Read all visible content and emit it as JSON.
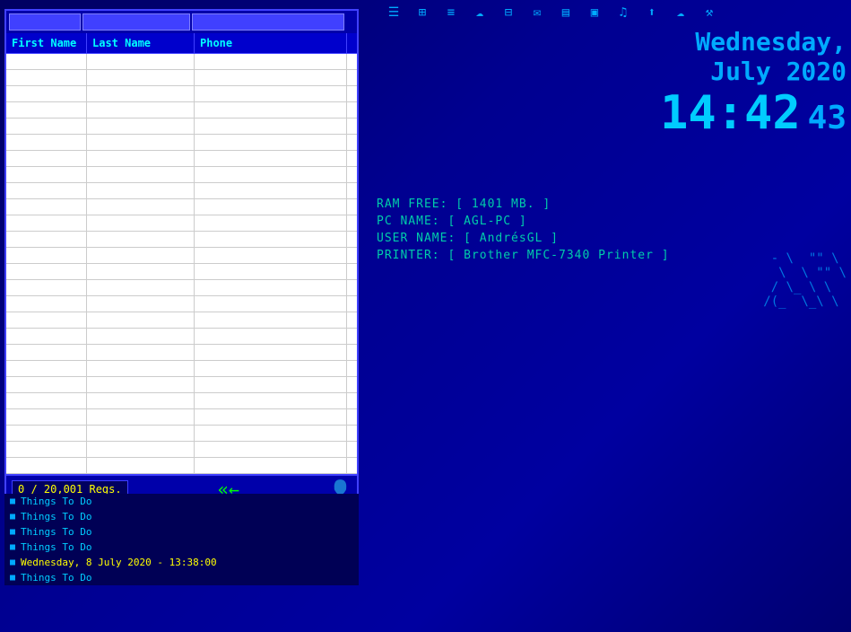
{
  "toolbar": {
    "icons": [
      {
        "name": "list-icon",
        "symbol": "☰"
      },
      {
        "name": "settings-icon",
        "symbol": "⚙"
      },
      {
        "name": "bullet-icon",
        "symbol": "≡"
      },
      {
        "name": "cloud-icon",
        "symbol": "☁"
      },
      {
        "name": "grid-icon",
        "symbol": "⊞"
      },
      {
        "name": "email-icon",
        "symbol": "✉"
      },
      {
        "name": "print-icon",
        "symbol": "⎙"
      },
      {
        "name": "monitor-icon",
        "symbol": "🖥"
      },
      {
        "name": "volume-icon",
        "symbol": "♪"
      },
      {
        "name": "upload-icon",
        "symbol": "⬆"
      },
      {
        "name": "cloud2-icon",
        "symbol": "☁"
      },
      {
        "name": "tool-icon",
        "symbol": "🔧"
      }
    ]
  },
  "address_book": {
    "search": {
      "first_placeholder": "",
      "last_placeholder": "",
      "phone_placeholder": ""
    },
    "columns": {
      "first": "First Name",
      "last": "Last Name",
      "phone": "Phone"
    },
    "row_count": 26,
    "footer": {
      "count": "0 / 20,001 Regs."
    }
  },
  "datetime": {
    "day": "Wednesday,",
    "month_year": "July   2020",
    "time": "14:42",
    "seconds": "43"
  },
  "system_info": {
    "ram": "RAM FREE:  [ 1401 MB. ]",
    "pc": "PC NAME:   [ AGL-PC ]",
    "user": "USER NAME: [ AndrésGL ]",
    "printer": "PRINTER:   [ Brother MFC-7340 Printer ]"
  },
  "ascii_art": "  -  \\ \"\" \\\n   \\  \\ \"\" \\\n  / \\_ \\ \\\n /(_  \\_\\ \\",
  "todos": [
    {
      "text": "Things To Do",
      "highlight": false
    },
    {
      "text": "Things To Do",
      "highlight": false
    },
    {
      "text": "Things To Do",
      "highlight": false
    },
    {
      "text": "Things To Do",
      "highlight": false
    },
    {
      "text": "Wednesday, 8 July  2020 - 13:38:00",
      "highlight": true
    },
    {
      "text": "Things To Do",
      "highlight": false
    }
  ]
}
